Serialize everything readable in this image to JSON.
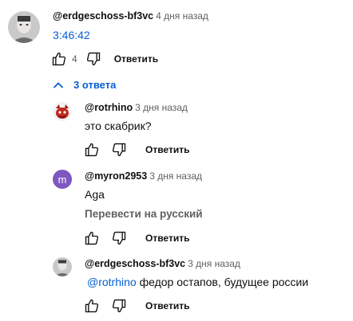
{
  "comment": {
    "author": "@erdgeschoss-bf3vc",
    "time": "4 дня назад",
    "timestamp_link": "3:46:42",
    "likes": "4",
    "reply_label": "Ответить"
  },
  "replies_toggle": {
    "label": "3 ответа"
  },
  "replies": [
    {
      "author": "@rotrhino",
      "time": "3 дня назад",
      "text": "это скабрик?",
      "reply_label": "Ответить"
    },
    {
      "author": "@myron2953",
      "time": "3 дня назад",
      "avatar_letter": "m",
      "avatar_color": "#7e57c2",
      "text": "Aga",
      "translate_label": "Перевести на русский",
      "reply_label": "Ответить"
    },
    {
      "author": "@erdgeschoss-bf3vc",
      "time": "3 дня назад",
      "mention": "@rotrhino",
      "text": " федор остапов, будущее россии",
      "reply_label": "Ответить"
    }
  ],
  "colors": {
    "link": "#065fd4",
    "muted": "#606060",
    "text": "#0f0f0f"
  }
}
